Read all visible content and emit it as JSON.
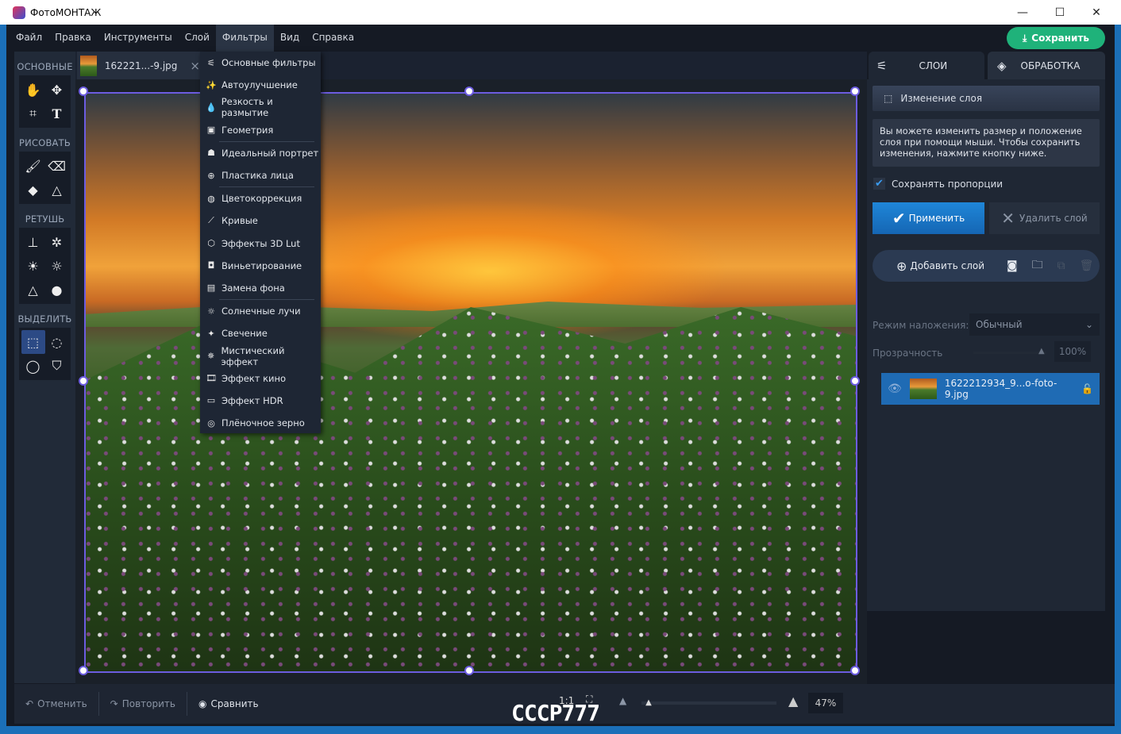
{
  "window": {
    "title": "ФотоМОНТАЖ",
    "min": "—",
    "max": "☐",
    "close": "✕"
  },
  "menu": [
    "Файл",
    "Правка",
    "Инструменты",
    "Слой",
    "Фильтры",
    "Вид",
    "Справка"
  ],
  "save_label": "Сохранить",
  "toolbar": {
    "sections": [
      "ОСНОВНЫЕ",
      "РИСОВАТЬ",
      "РЕТУШЬ",
      "ВЫДЕЛИТЬ"
    ]
  },
  "file_tab": {
    "name": "162221...-9.jpg",
    "close": "×"
  },
  "filters_menu": [
    {
      "label": "Основные фильтры",
      "icon": "sliders-icon"
    },
    {
      "label": "Автоулучшение",
      "icon": "magic-wand-icon"
    },
    {
      "label": "Резкость и размытие",
      "icon": "drop-icon"
    },
    {
      "label": "Геометрия",
      "icon": "image-icon"
    },
    {
      "label": "Идеальный портрет",
      "icon": "portrait-icon"
    },
    {
      "label": "Пластика лица",
      "icon": "face-icon"
    },
    {
      "label": "Цветокоррекция",
      "icon": "palette-icon"
    },
    {
      "label": "Кривые",
      "icon": "curve-icon"
    },
    {
      "label": "Эффекты 3D Lut",
      "icon": "cube-icon"
    },
    {
      "label": "Виньетирование",
      "icon": "vignette-icon"
    },
    {
      "label": "Замена фона",
      "icon": "background-icon"
    },
    {
      "label": "Солнечные лучи",
      "icon": "sun-icon"
    },
    {
      "label": "Свечение",
      "icon": "sparkle-icon"
    },
    {
      "label": "Мистический эффект",
      "icon": "mystic-icon"
    },
    {
      "label": "Эффект кино",
      "icon": "film-icon"
    },
    {
      "label": "Эффект HDR",
      "icon": "hdr-icon"
    },
    {
      "label": "Плёночное зерно",
      "icon": "grain-icon"
    }
  ],
  "right_panel": {
    "tabs": [
      "СЛОИ",
      "ОБРАБОТКА"
    ],
    "layer_edit_title": "Изменение слоя",
    "info": "Вы можете изменить размер и положение слоя при помощи мыши. Чтобы сохранить изменения, нажмите кнопку ниже.",
    "keep_proportions": "Сохранять пропорции",
    "keep_proportions_checked": true,
    "apply": "Применить",
    "delete_layer": "Удалить слой",
    "add_layer": "Добавить слой",
    "blend_label": "Режим наложения:",
    "blend_value": "Обычный",
    "opacity_label": "Прозрачность",
    "opacity_value": "100%",
    "layer_name": "1622212934_9...o-foto-9.jpg"
  },
  "bottom": {
    "undo": "Отменить",
    "redo": "Повторить",
    "compare": "Сравнить",
    "one_to_one": "1:1",
    "zoom": "47%",
    "zoom_fraction": 0.03
  },
  "watermark": "СССР777",
  "colors": {
    "accent": "#1fb27a",
    "apply": "#1a7bd0",
    "selection": "#6c5ce0",
    "layer_selected": "#1f6bb4"
  }
}
